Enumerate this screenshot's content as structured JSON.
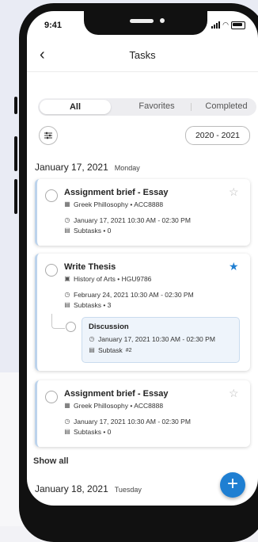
{
  "status": {
    "time": "9:41"
  },
  "header": {
    "back_icon": "‹",
    "title": "Tasks"
  },
  "segments": {
    "all": "All",
    "favorites": "Favorites",
    "completed": "Completed"
  },
  "filter": {
    "year": "2020 - 2021"
  },
  "groups": [
    {
      "date": "January 17, 2021",
      "dow": "Monday"
    },
    {
      "date": "January 18, 2021",
      "dow": "Tuesday"
    }
  ],
  "tasks": [
    {
      "title": "Assignment brief - Essay",
      "course": "Greek Phillosophy • ACC8888",
      "time": "January 17, 2021 10:30 AM - 02:30 PM",
      "subtasks": "Subtasks • 0",
      "starred": false
    },
    {
      "title": "Write Thesis",
      "course": "History of Arts • HGU9786",
      "time": "February 24, 2021 10:30 AM - 02:30 PM",
      "subtasks": "Subtasks • 3",
      "starred": true,
      "subtask": {
        "title": "Discussion",
        "time": "January 17, 2021 10:30 AM - 02:30 PM",
        "label": "Subtask",
        "number": "#2"
      }
    },
    {
      "title": "Assignment brief - Essay",
      "course": "Greek Phillosophy • ACC8888",
      "time": "January 17, 2021 10:30 AM - 02:30 PM",
      "subtasks": "Subtasks • 0",
      "starred": false
    }
  ],
  "show_all": "Show all",
  "fab": "+",
  "colors": {
    "accent": "#1f7fd2",
    "card_border": "#bcd3ec"
  }
}
